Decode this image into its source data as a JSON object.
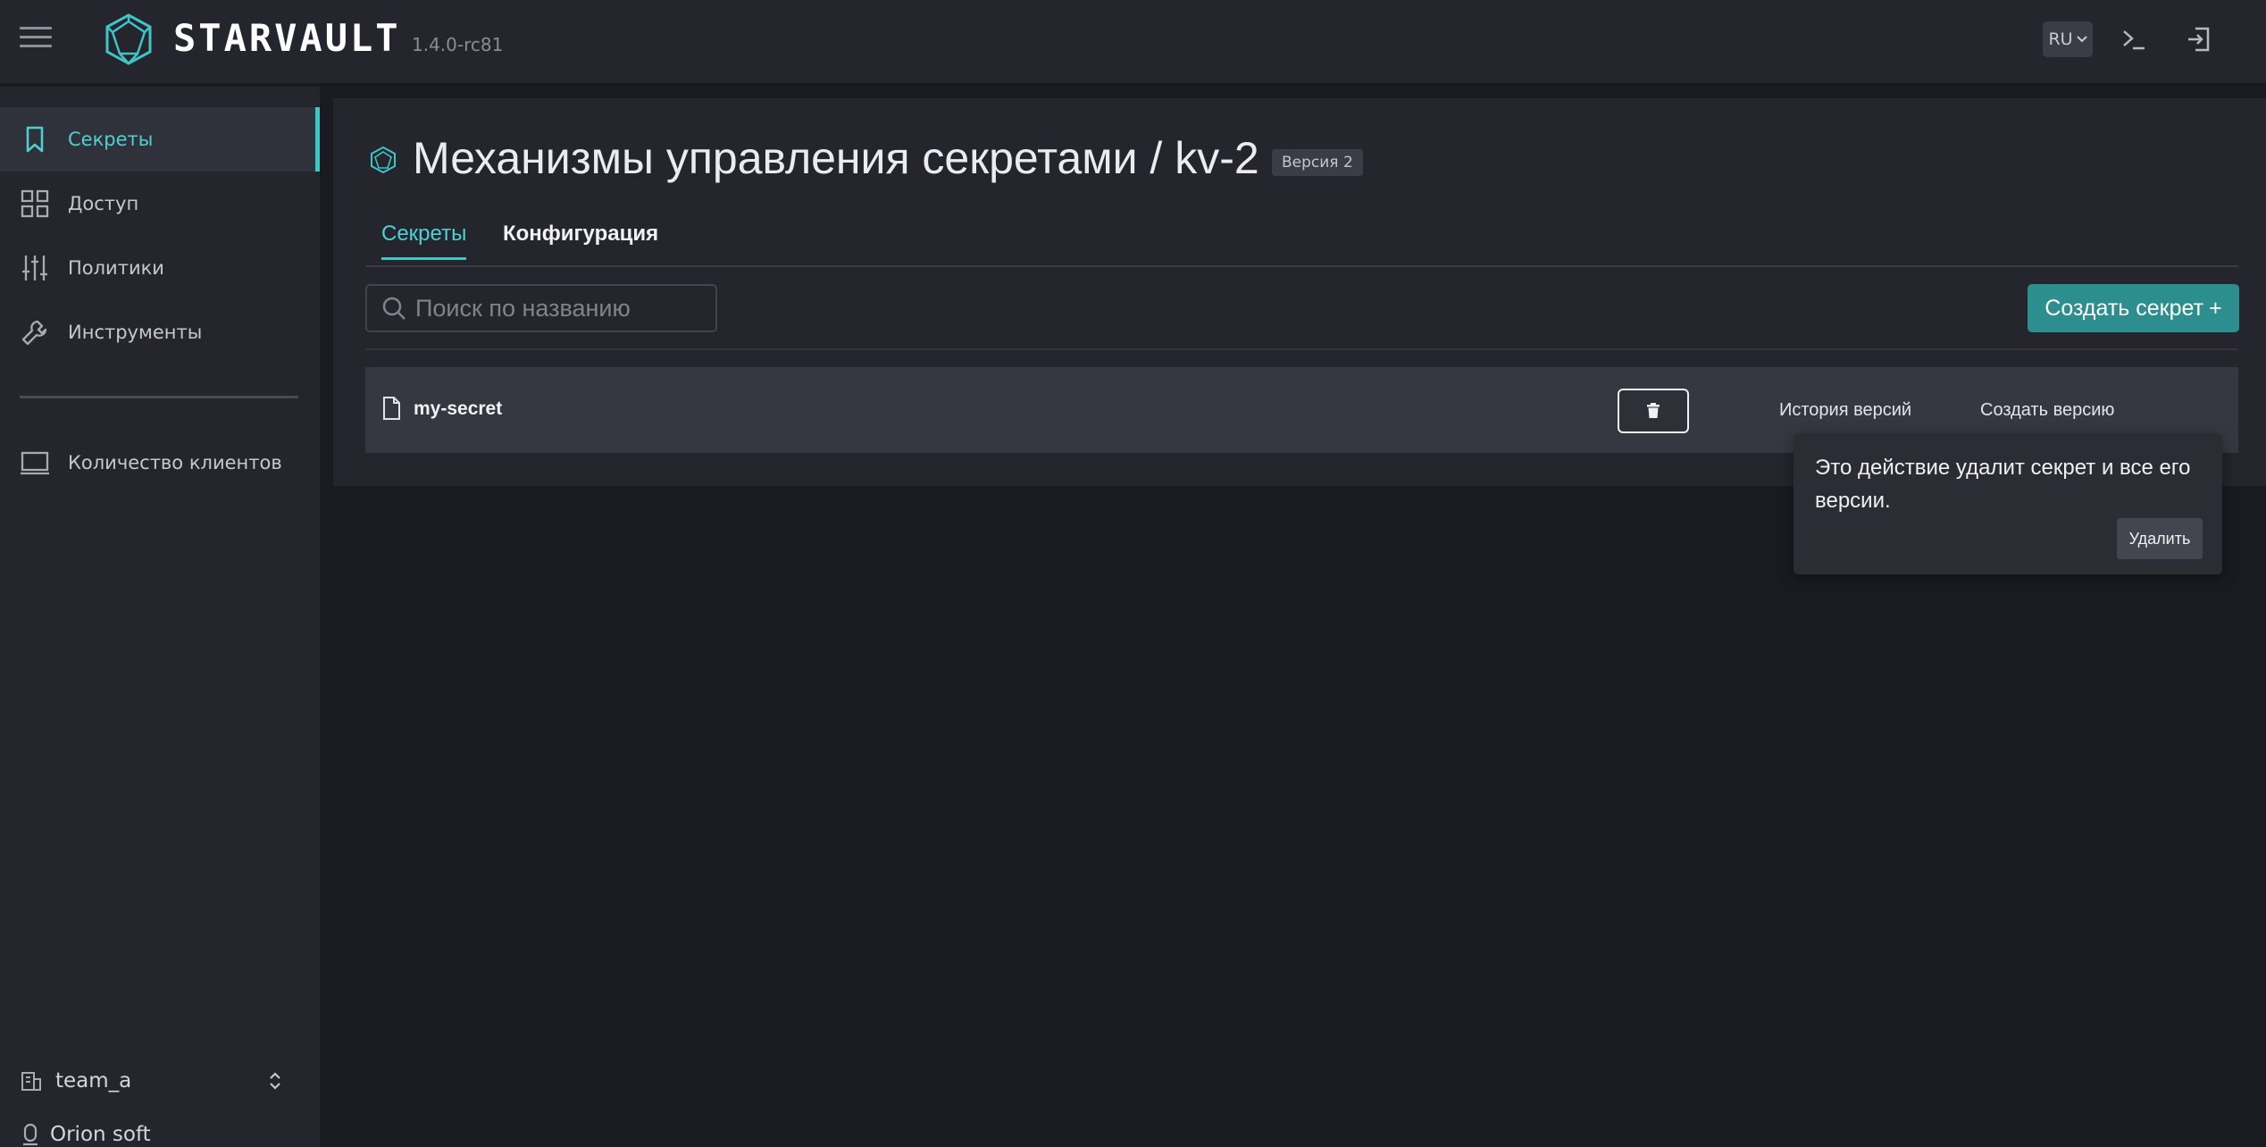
{
  "app": {
    "name": "STARVAULT",
    "version": "1.4.0-rc81"
  },
  "header": {
    "language": "RU"
  },
  "sidebar": {
    "items": [
      {
        "label": "Секреты",
        "icon": "bookmark-icon",
        "active": true
      },
      {
        "label": "Доступ",
        "icon": "grid-icon",
        "active": false
      },
      {
        "label": "Политики",
        "icon": "sliders-icon",
        "active": false
      },
      {
        "label": "Инструменты",
        "icon": "wrench-icon",
        "active": false
      },
      {
        "label": "Количество клиентов",
        "icon": "monitor-icon",
        "active": false
      }
    ],
    "team": "team_a",
    "org": "Orion soft"
  },
  "main": {
    "title": "Механизмы управления секретами / kv-2",
    "version_badge": "Версия 2",
    "tabs": [
      {
        "label": "Секреты",
        "active": true
      },
      {
        "label": "Конфигурация",
        "active": false
      }
    ],
    "search_placeholder": "Поиск по названию",
    "create_button": "Создать секрет",
    "create_button_icon": "+",
    "secrets": [
      {
        "name": "my-secret",
        "history_label": "История версий",
        "create_version_label": "Создать версию"
      }
    ]
  },
  "popover": {
    "message": "Это действие удалит секрет и все его версии.",
    "confirm_label": "Удалить"
  },
  "colors": {
    "accent": "#3fc5c6",
    "primary_button": "#2c8e8f",
    "background": "#1a1b21",
    "surface": "#24252d"
  }
}
